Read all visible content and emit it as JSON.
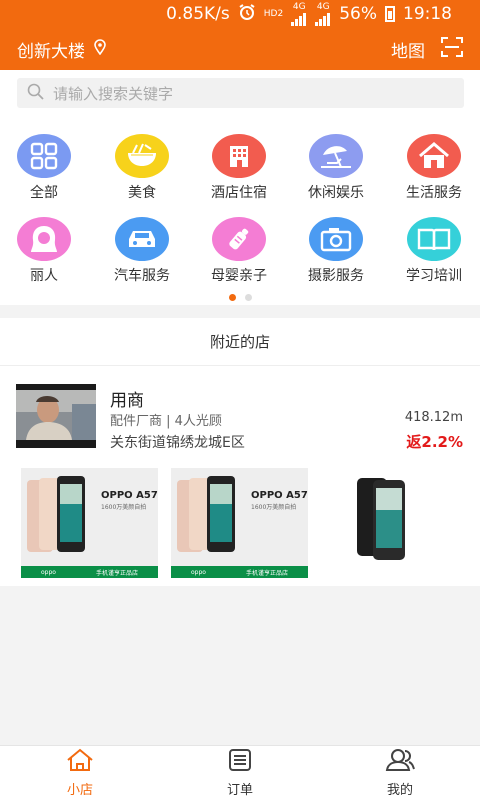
{
  "status_bar": {
    "speed": "0.85K/s",
    "network_hd": "HD2",
    "network_4g_a": "4G",
    "network_4g_b": "4G",
    "battery": "56%",
    "time": "19:18"
  },
  "header": {
    "location": "创新大楼",
    "location_icon": "location-pin-icon",
    "map_label": "地图",
    "scan_icon": "scan-icon"
  },
  "search": {
    "placeholder": "请输入搜索关键字"
  },
  "categories": [
    {
      "label": "全部",
      "icon": "grid-icon",
      "color": "#7b9af2"
    },
    {
      "label": "美食",
      "icon": "noodle-bowl-icon",
      "color": "#f7d21b"
    },
    {
      "label": "酒店住宿",
      "icon": "hotel-icon",
      "color": "#f25c4f"
    },
    {
      "label": "休闲娱乐",
      "icon": "beach-umbrella-icon",
      "color": "#8d9cf0"
    },
    {
      "label": "生活服务",
      "icon": "house-icon",
      "color": "#f25c4f"
    },
    {
      "label": "丽人",
      "icon": "woman-head-icon",
      "color": "#f47dd4"
    },
    {
      "label": "汽车服务",
      "icon": "car-icon",
      "color": "#4b9bf2"
    },
    {
      "label": "母婴亲子",
      "icon": "baby-bottle-icon",
      "color": "#f47dd4"
    },
    {
      "label": "摄影服务",
      "icon": "camera-icon",
      "color": "#4b9bf2"
    },
    {
      "label": "学习培训",
      "icon": "book-icon",
      "color": "#35d0d9"
    }
  ],
  "pager": {
    "pages": 2,
    "active": 1
  },
  "nearby": {
    "title": "附近的店",
    "shops": [
      {
        "name": "用商",
        "meta": "配件厂商 | 4人光顾",
        "distance": "418.12m",
        "address": "关东街道锦绣龙城E区",
        "rebate": "返2.2%",
        "products": [
          {
            "name": "OPPO A57",
            "sub": "1600万美颜自拍",
            "brand": "oppo",
            "store": "手机谨亨正品店"
          },
          {
            "name": "OPPO A57",
            "sub": "1600万美颜自拍",
            "brand": "oppo",
            "store": "手机谨亨正品店"
          },
          {
            "name": "",
            "sub": "",
            "brand": "",
            "store": ""
          }
        ]
      }
    ]
  },
  "bottom_nav": [
    {
      "label": "小店",
      "icon": "house-outline-icon",
      "active": true
    },
    {
      "label": "订单",
      "icon": "list-icon",
      "active": false
    },
    {
      "label": "我的",
      "icon": "user-icon",
      "active": false
    }
  ],
  "colors": {
    "accent": "#f26a0f",
    "rebate": "#e31a1a"
  }
}
